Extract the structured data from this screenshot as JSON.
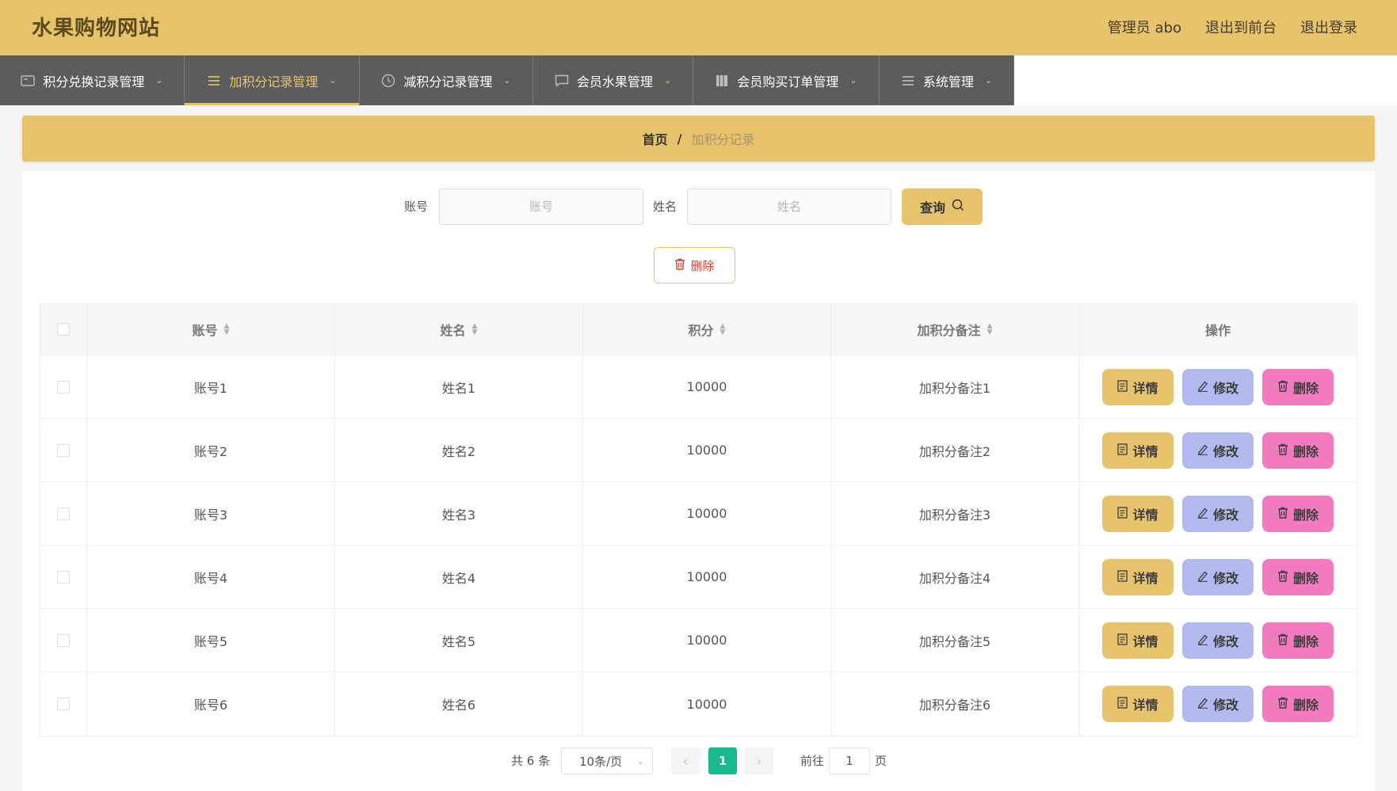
{
  "header": {
    "title": "水果购物网站",
    "links": [
      "管理员 abo",
      "退出到前台",
      "退出登录"
    ]
  },
  "nav": {
    "items": [
      {
        "label": "积分兑换记录管理",
        "icon": "card-icon",
        "active": false
      },
      {
        "label": "加积分记录管理",
        "icon": "list-icon",
        "active": true
      },
      {
        "label": "减积分记录管理",
        "icon": "clock-icon",
        "active": false
      },
      {
        "label": "会员水果管理",
        "icon": "message-icon",
        "active": false
      },
      {
        "label": "会员购买订单管理",
        "icon": "book-icon",
        "active": false
      },
      {
        "label": "系统管理",
        "icon": "menu-icon",
        "active": false
      }
    ]
  },
  "breadcrumb": {
    "home": "首页",
    "separator": "/",
    "current": "加积分记录"
  },
  "search": {
    "account_label": "账号",
    "account_placeholder": "账号",
    "name_label": "姓名",
    "name_placeholder": "姓名",
    "query_label": "查询"
  },
  "bulk_delete_label": "删除",
  "table": {
    "headers": [
      "账号",
      "姓名",
      "积分",
      "加积分备注",
      "操作"
    ],
    "rows": [
      {
        "account": "账号1",
        "name": "姓名1",
        "points": "10000",
        "note": "加积分备注1"
      },
      {
        "account": "账号2",
        "name": "姓名2",
        "points": "10000",
        "note": "加积分备注2"
      },
      {
        "account": "账号3",
        "name": "姓名3",
        "points": "10000",
        "note": "加积分备注3"
      },
      {
        "account": "账号4",
        "name": "姓名4",
        "points": "10000",
        "note": "加积分备注4"
      },
      {
        "account": "账号5",
        "name": "姓名5",
        "points": "10000",
        "note": "加积分备注5"
      },
      {
        "account": "账号6",
        "name": "姓名6",
        "points": "10000",
        "note": "加积分备注6"
      }
    ],
    "actions": {
      "detail": "详情",
      "edit": "修改",
      "delete": "删除"
    }
  },
  "pagination": {
    "total": "共 6 条",
    "page_size": "10条/页",
    "current_page": "1",
    "goto_label": "前往",
    "goto_value": "1",
    "page_suffix": "页"
  },
  "colors": {
    "accent": "#e7c46c",
    "edit": "#b3b8ef",
    "delete": "#f57bc0",
    "current_page": "#19b98b",
    "nav_bg": "#5c5c5c"
  }
}
